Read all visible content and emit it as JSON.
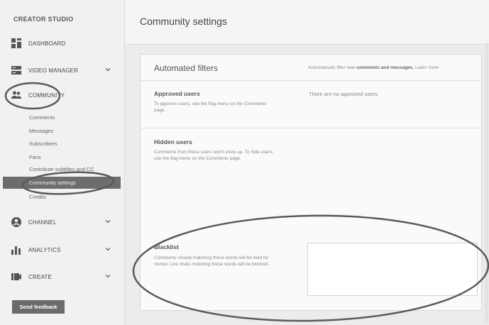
{
  "sidebar": {
    "brand": "CREATOR STUDIO",
    "items": [
      {
        "label": "DASHBOARD",
        "icon": "dashboard-icon"
      },
      {
        "label": "VIDEO MANAGER",
        "icon": "video-manager-icon"
      },
      {
        "label": "COMMUNITY",
        "icon": "community-icon"
      },
      {
        "label": "CHANNEL",
        "icon": "channel-icon"
      },
      {
        "label": "ANALYTICS",
        "icon": "analytics-icon"
      },
      {
        "label": "CREATE",
        "icon": "create-icon"
      }
    ],
    "community_sub": {
      "comments": "Comments",
      "messages": "Messages",
      "subscribers": "Subscribers",
      "fans": "Fans",
      "contribute": "Contribute subtitles and CC",
      "community_settings": "Community settings",
      "credits": "Credits"
    },
    "feedback_label": "Send feedback"
  },
  "main": {
    "page_title": "Community settings",
    "card": {
      "title": "Automated filters",
      "description": "Automatically filter new",
      "description_bold": "comments and messages.",
      "learn_more": "Learn more"
    },
    "approved": {
      "label": "Approved users",
      "help": "To approve users, use the flag menu on the Comments page.",
      "empty": "There are no approved users."
    },
    "hidden": {
      "label": "Hidden users",
      "help": "Comments from these users won't show up. To hide users, use the flag menu on the Comments page."
    },
    "blacklist": {
      "label": "Blacklist",
      "help": "Comments closely matching these words will be held for review. Live chats matching these words will be blocked."
    }
  },
  "colors": {
    "annotation": "#5a5a5a",
    "active_item": "#6d6d6d"
  }
}
